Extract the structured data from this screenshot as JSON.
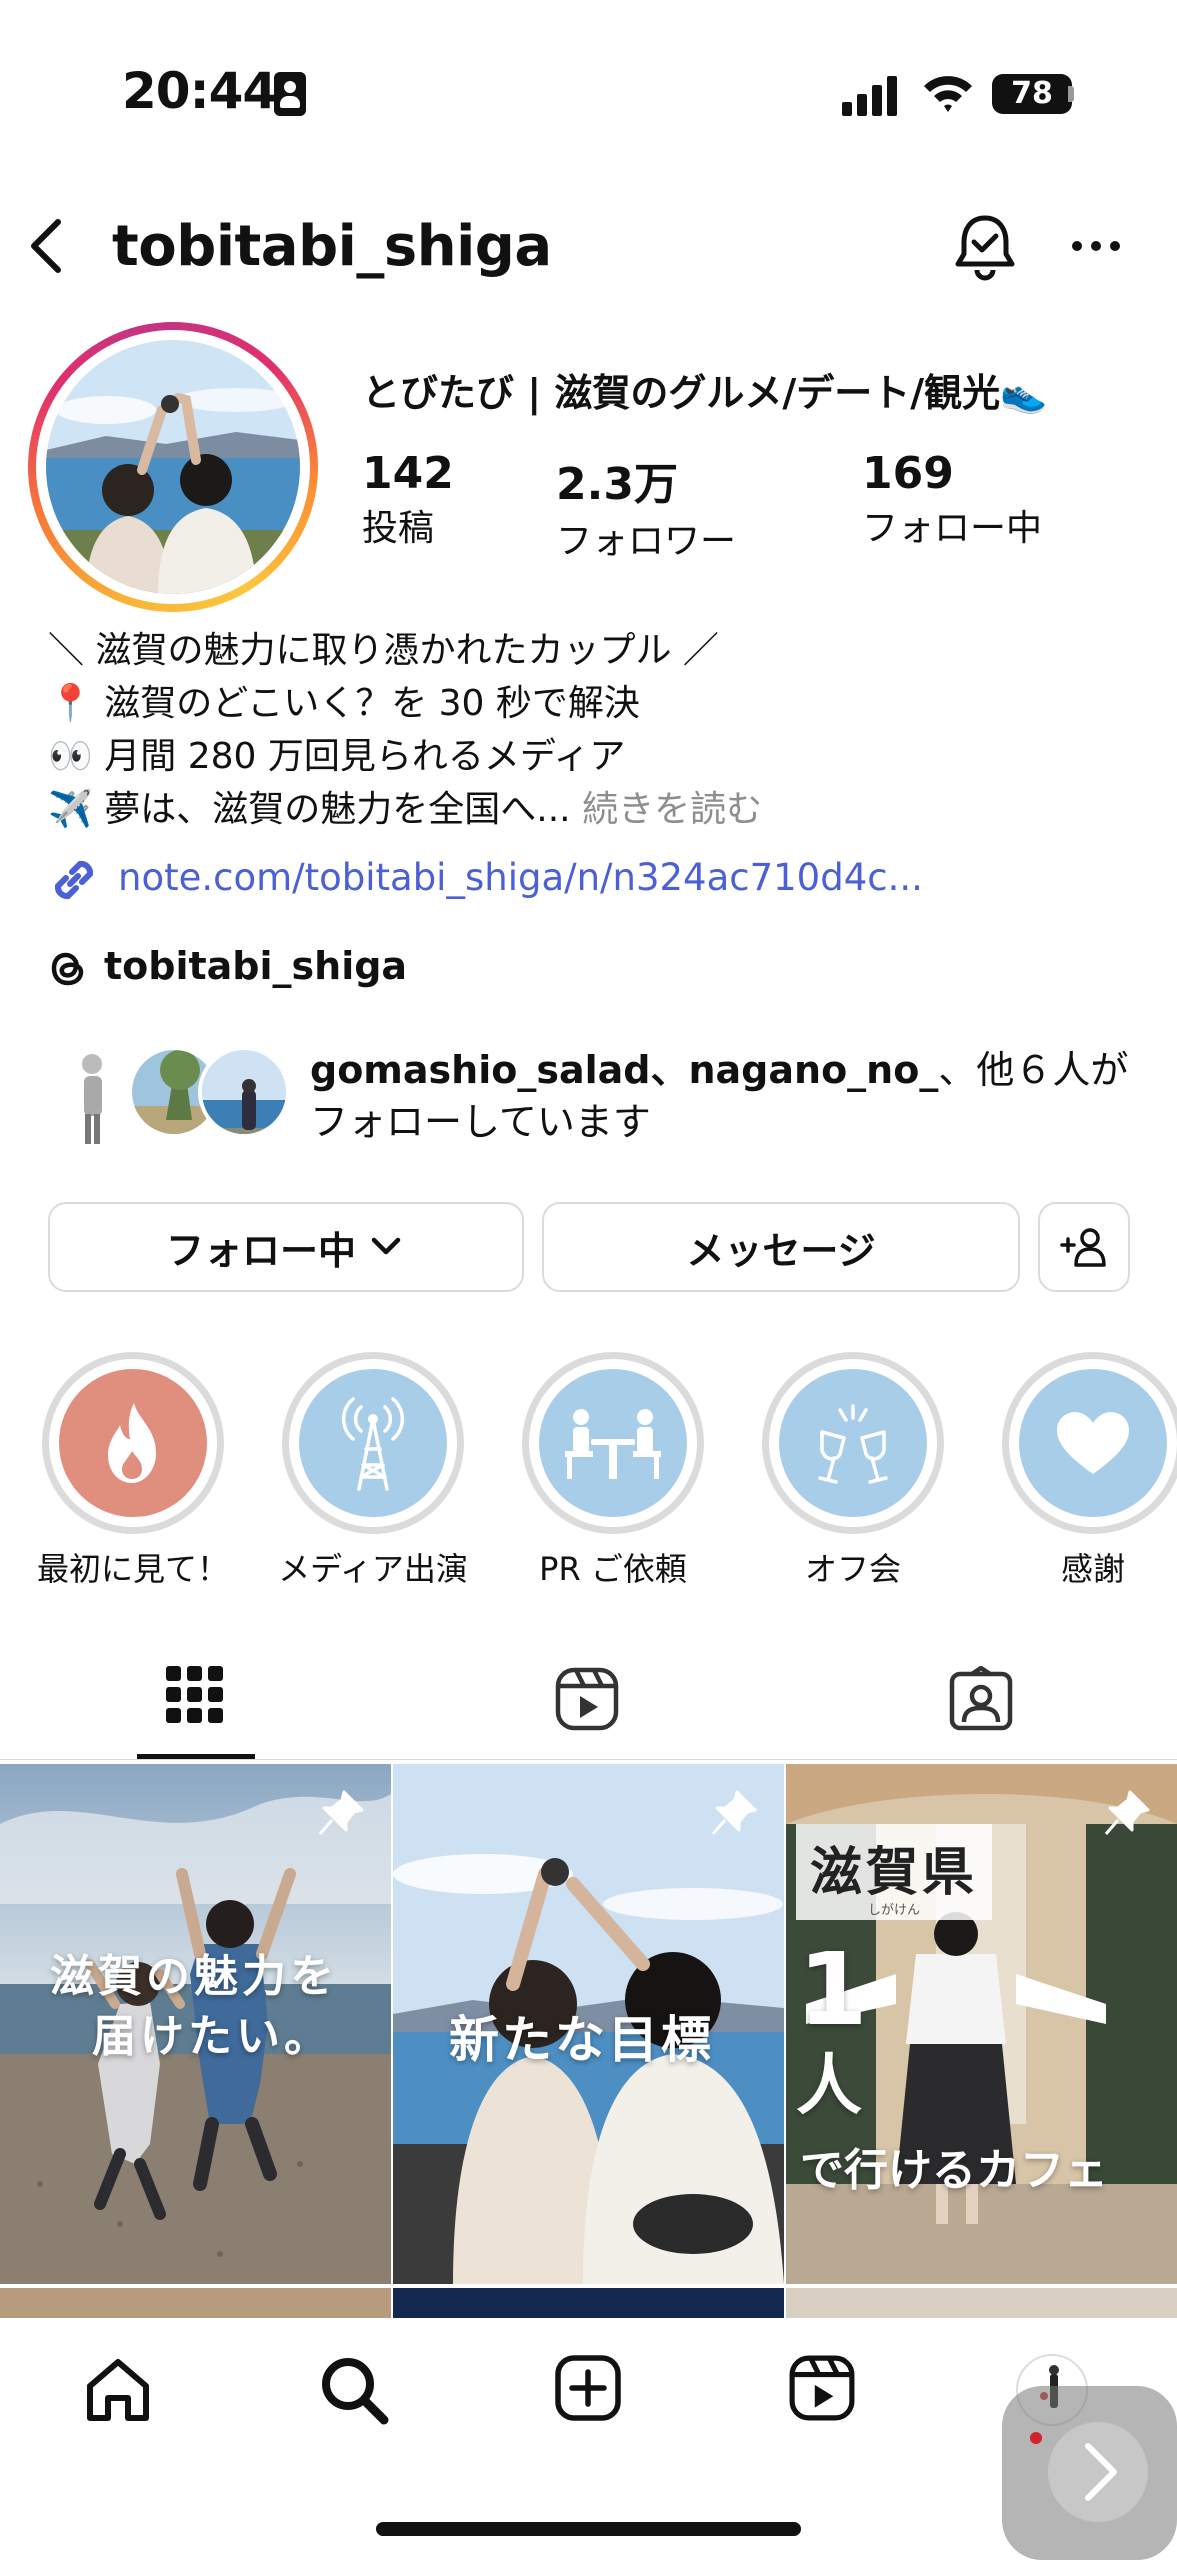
{
  "status_bar": {
    "time": "20:44",
    "battery": "78"
  },
  "header": {
    "username": "tobitabi_shiga"
  },
  "profile": {
    "display_name": "とびたび | 滋賀のグルメ/デート/観光👟",
    "stats": [
      {
        "value": "142",
        "label": "投稿"
      },
      {
        "value": "2.3万",
        "label": "フォロワー"
      },
      {
        "value": "169",
        "label": "フォロー中"
      }
    ],
    "bio_lines": [
      "＼ 滋賀の魅力に取り憑かれたカップル ／",
      "📍 滋賀のどこいく？を 30 秒で解決",
      "👀 月間 280 万回見られるメディア",
      "✈️ 夢は、滋賀の魅力を全国へ..."
    ],
    "bio_more": "続きを読む",
    "link": "note.com/tobitabi_shiga/n/n324ac710d4c...",
    "threads_handle": "tobitabi_shiga",
    "followed_by_names": "gomashio_salad、nagano_no_",
    "followed_by_rest": "、他６人が",
    "followed_by_line2": "フォローしています"
  },
  "actions": {
    "following_label": "フォロー中",
    "message_label": "メッセージ"
  },
  "highlights": [
    {
      "label": "最初に見て！",
      "icon": "flame-icon",
      "color": "#e08f7f"
    },
    {
      "label": "メディア出演",
      "icon": "antenna-icon",
      "color": "#a8cde9"
    },
    {
      "label": "PR ご依頼",
      "icon": "meeting-icon",
      "color": "#a8cde9"
    },
    {
      "label": "オフ会",
      "icon": "toast-icon",
      "color": "#a8cde9"
    },
    {
      "label": "感謝",
      "icon": "heart-icon",
      "color": "#a8cde9"
    }
  ],
  "tabs": [
    "grid-icon",
    "reels-icon",
    "tagged-icon"
  ],
  "posts": [
    {
      "line1": "滋賀の魅力を",
      "line2": "届けたい。",
      "pinned": true
    },
    {
      "line1": "新たな目標",
      "pinned": true
    },
    {
      "badge": "滋賀県",
      "badge_sub": "しがけん",
      "big": "1",
      "big2": "人",
      "line": "で行けるカフェ",
      "pinned": true
    }
  ]
}
